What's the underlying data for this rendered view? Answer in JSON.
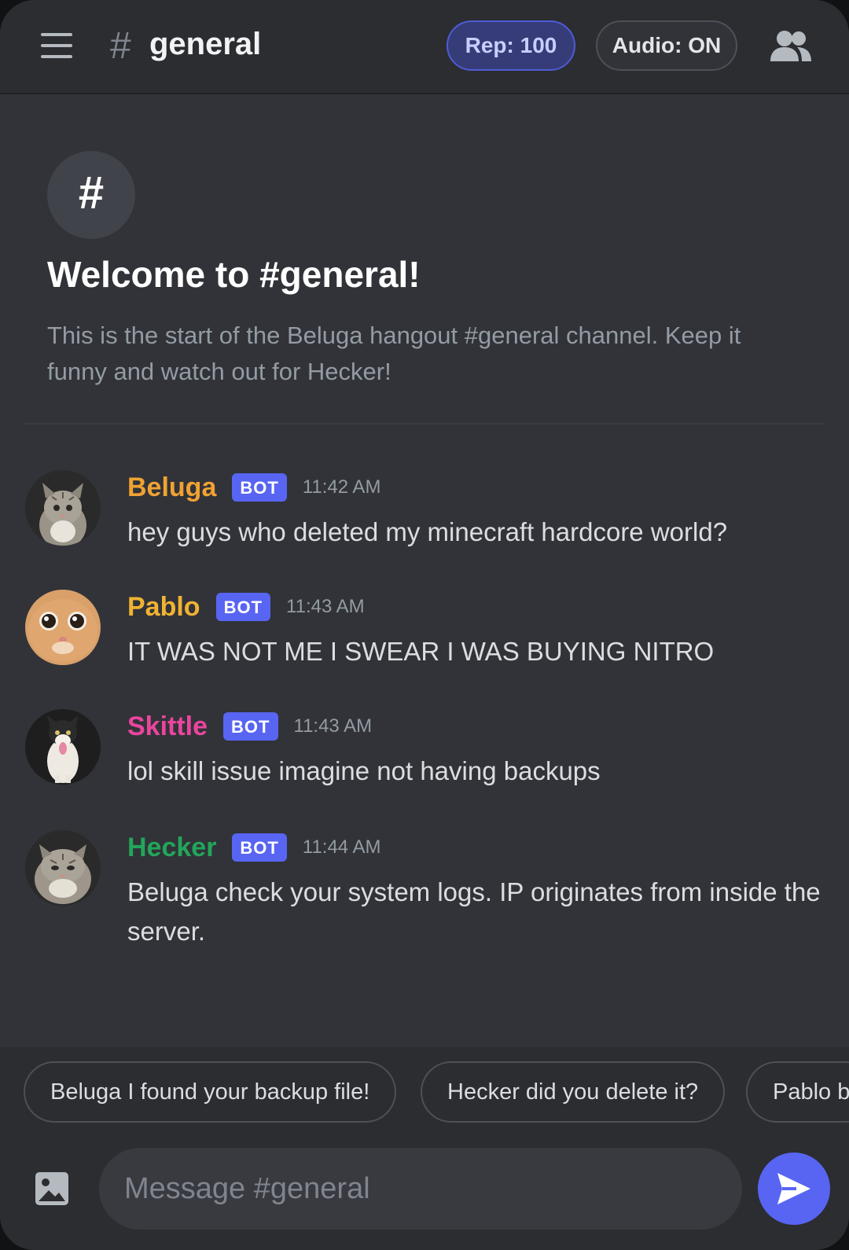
{
  "header": {
    "hash": "#",
    "channel": "general",
    "rep_label": "Rep: 100",
    "audio_label": "Audio: ON",
    "menu_icon": "hamburger-menu-icon",
    "members_icon": "members-icon"
  },
  "welcome": {
    "icon": "#",
    "title": "Welcome to #general!",
    "description": "This is the start of the Beluga hangout #general channel. Keep it funny and watch out for Hecker!"
  },
  "messages": [
    {
      "author": "Beluga",
      "badge": "BOT",
      "time": "11:42 AM",
      "text": "hey guys who deleted my minecraft hardcore world?",
      "color": "#f0a232"
    },
    {
      "author": "Pablo",
      "badge": "BOT",
      "time": "11:43 AM",
      "text": "IT WAS NOT ME I SWEAR I WAS BUYING NITRO",
      "color": "#f0b232"
    },
    {
      "author": "Skittle",
      "badge": "BOT",
      "time": "11:43 AM",
      "text": "lol skill issue imagine not having backups",
      "color": "#eb459e"
    },
    {
      "author": "Hecker",
      "badge": "BOT",
      "time": "11:44 AM",
      "text": "Beluga check your system logs. IP originates from inside the server.",
      "color": "#23a55a"
    }
  ],
  "suggestions": [
    "Beluga I found your backup file!",
    "Hecker did you delete it?",
    "Pablo b"
  ],
  "composer": {
    "placeholder": "Message #general",
    "attach_icon": "image-icon",
    "send_icon": "send-icon"
  },
  "colors": {
    "background": "#313338",
    "header": "#2b2d31",
    "accent": "#5865f2"
  }
}
